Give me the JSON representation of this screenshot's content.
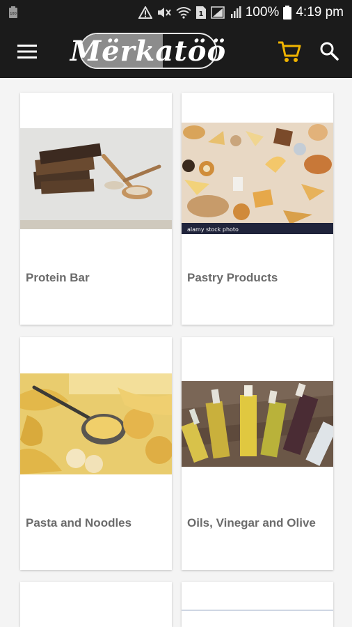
{
  "status_bar": {
    "battery_percent": "100%",
    "time": "4:19 pm",
    "icons": [
      "battery-saver-icon",
      "warning-icon",
      "mute-icon",
      "wifi-icon",
      "sim-icon",
      "signal-icon",
      "battery-icon"
    ]
  },
  "app_bar": {
    "brand": "Mërkatöö",
    "icons": [
      "menu-icon",
      "cart-icon",
      "search-icon"
    ],
    "accent_color": "#f0b400",
    "background": "#1b1b1b"
  },
  "categories": [
    {
      "label": "Protein Bar",
      "image": "protein-bar-image"
    },
    {
      "label": "Pastry Products",
      "image": "pastry-products-image",
      "image_caption": "alamy stock photo"
    },
    {
      "label": "Pasta and Noodles",
      "image": "pasta-noodles-image"
    },
    {
      "label": "Oils, Vinegar and Olive",
      "image": "oils-vinegar-olive-image"
    }
  ]
}
